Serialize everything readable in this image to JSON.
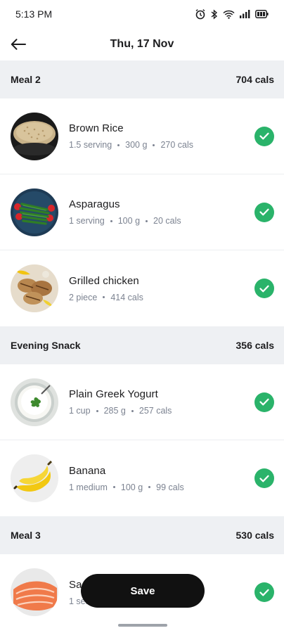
{
  "status_bar": {
    "time": "5:13 PM",
    "icons": [
      "alarm-icon",
      "bluetooth-icon",
      "wifi-icon",
      "signal-icon",
      "battery-icon"
    ]
  },
  "header": {
    "title": "Thu, 17 Nov",
    "back_icon": "back-arrow-icon"
  },
  "sections": [
    {
      "title": "Meal 2",
      "cals": "704 cals",
      "items": [
        {
          "name": "Brown Rice",
          "meta": [
            "1.5 serving",
            "300 g",
            "270 cals"
          ],
          "thumb": "brown-rice"
        },
        {
          "name": "Asparagus",
          "meta": [
            "1 serving",
            "100 g",
            "20 cals"
          ],
          "thumb": "asparagus"
        },
        {
          "name": "Grilled chicken",
          "meta": [
            "2 piece",
            "414 cals"
          ],
          "thumb": "grilled-chicken"
        }
      ]
    },
    {
      "title": "Evening Snack",
      "cals": "356 cals",
      "items": [
        {
          "name": "Plain Greek Yogurt",
          "meta": [
            "1 cup",
            "285 g",
            "257 cals"
          ],
          "thumb": "yogurt"
        },
        {
          "name": "Banana",
          "meta": [
            "1 medium",
            "100 g",
            "99 cals"
          ],
          "thumb": "banana"
        }
      ]
    },
    {
      "title": "Meal 3",
      "cals": "530 cals",
      "items": [
        {
          "name": "Sa",
          "meta": [
            "1 serv"
          ],
          "thumb": "salmon"
        }
      ]
    }
  ],
  "save_button": {
    "label": "Save"
  },
  "colors": {
    "accent_green": "#2ab36a",
    "section_bg": "#eef0f3",
    "save_bg": "#111111"
  }
}
